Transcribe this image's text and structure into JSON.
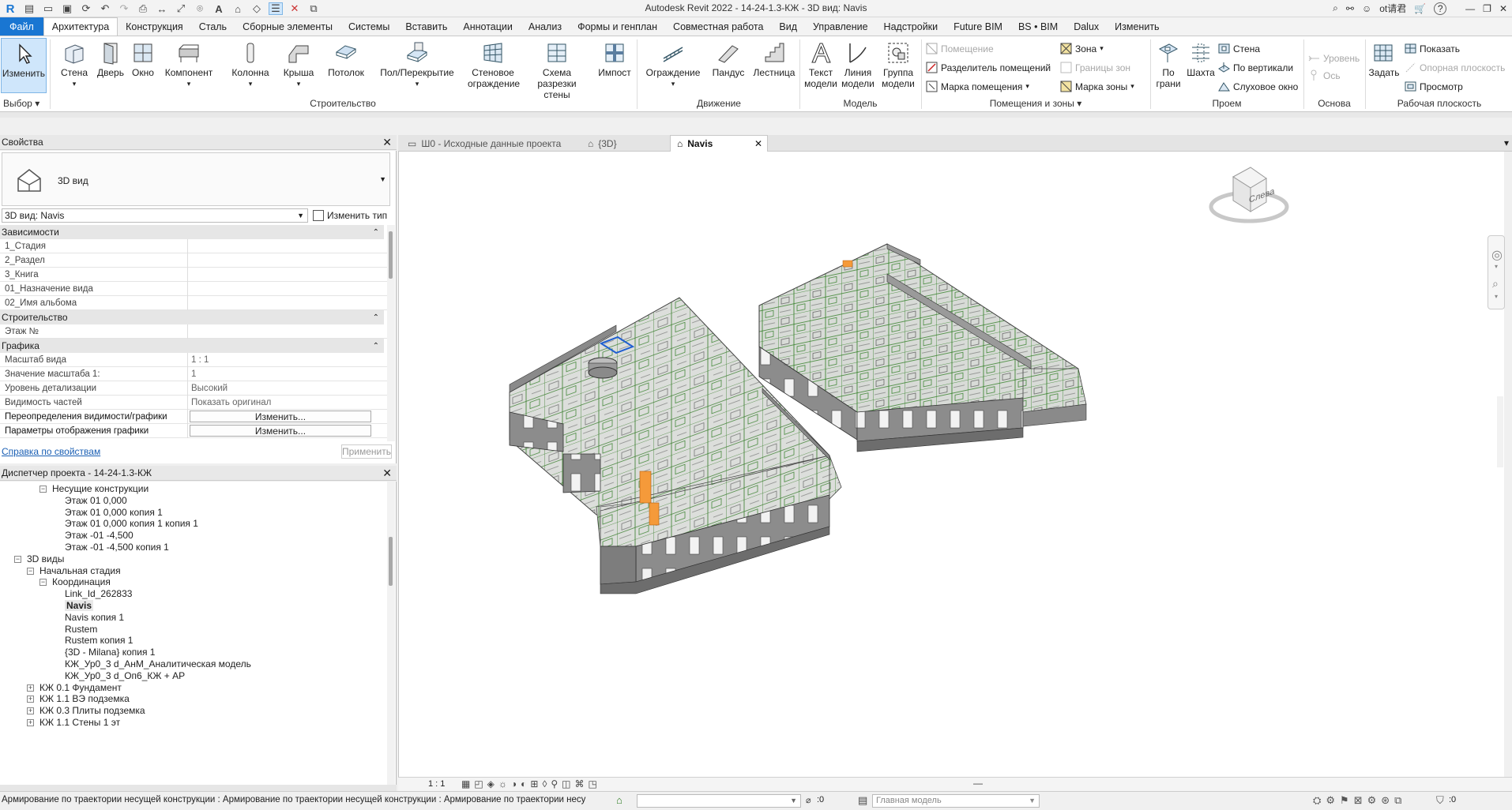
{
  "app": {
    "title": "Autodesk Revit 2022 - 14-24-1.3-КЖ - 3D вид: Navis",
    "right": {
      "user": "ot请君",
      "help": "?"
    }
  },
  "menu": {
    "tabs": [
      "Файл",
      "Архитектура",
      "Конструкция",
      "Сталь",
      "Сборные элементы",
      "Системы",
      "Вставить",
      "Аннотации",
      "Анализ",
      "Формы и генплан",
      "Совместная работа",
      "Вид",
      "Управление",
      "Надстройки",
      "Future BIM",
      "BS • BIM",
      "Dalux",
      "Изменить"
    ],
    "active": "Архитектура"
  },
  "ribbon": {
    "select": {
      "modify": "Изменить",
      "group": "Выбор"
    },
    "build": {
      "wall": "Стена",
      "door": "Дверь",
      "window": "Окно",
      "component": "Компонент",
      "column": "Колонна",
      "roof": "Крыша",
      "ceiling": "Потолок",
      "floor": "Пол/Перекрытие",
      "curtain_wall": "Стеновое ограждение",
      "curtain_grid": "Схема разрезки стены",
      "mullion": "Импост",
      "group": "Строительство"
    },
    "circulation": {
      "railing": "Ограждение",
      "ramp": "Пандус",
      "stair": "Лестница",
      "group": "Движение"
    },
    "model": {
      "text": "Текст модели",
      "line": "Линия модели",
      "group_btn": "Группа модели",
      "group": "Модель"
    },
    "rooms": {
      "room": "Помещение",
      "separator": "Разделитель помещений",
      "tag": "Марка помещения",
      "area": "Зона",
      "area_boundary": "Границы зон",
      "area_tag": "Марка зоны",
      "group": "Помещения и зоны"
    },
    "opening": {
      "by_face": "По грани",
      "shaft": "Шахта",
      "wall": "Стена",
      "vertical": "По вертикали",
      "dormer": "Слуховое окно",
      "group": "Проем"
    },
    "datum": {
      "level": "Уровень",
      "grid": "Ось",
      "group": "Основа"
    },
    "workplane": {
      "set": "Задать",
      "show": "Показать",
      "ref_plane": "Опорная плоскость",
      "viewer": "Просмотр",
      "group": "Рабочая плоскость"
    }
  },
  "properties": {
    "title": "Свойства",
    "type_name": "3D вид",
    "selector": "3D вид: Navis",
    "edit_type": "Изменить тип",
    "sections": [
      {
        "name": "Зависимости",
        "rows": [
          {
            "k": "1_Стадия",
            "v": ""
          },
          {
            "k": "2_Раздел",
            "v": ""
          },
          {
            "k": "3_Книга",
            "v": ""
          },
          {
            "k": "01_Назначение вида",
            "v": ""
          },
          {
            "k": "02_Имя альбома",
            "v": ""
          }
        ]
      },
      {
        "name": "Строительство",
        "rows": [
          {
            "k": "Этаж №",
            "v": ""
          }
        ]
      },
      {
        "name": "Графика",
        "rows": [
          {
            "k": "Масштаб вида",
            "v": "1 : 1"
          },
          {
            "k": "Значение масштаба    1:",
            "v": "1"
          },
          {
            "k": "Уровень детализации",
            "v": "Высокий"
          },
          {
            "k": "Видимость частей",
            "v": "Показать оригинал"
          }
        ]
      }
    ],
    "vg_overrides": "Переопределения видимости/графики",
    "display_options": "Параметры отображения графики",
    "edit_btn": "Изменить...",
    "help_link": "Справка по свойствам",
    "apply": "Применить"
  },
  "browser": {
    "title": "Диспетчер проекта - 14-24-1.3-КЖ",
    "items": [
      {
        "label": "Несущие конструкции",
        "indent": 4,
        "toggle": "−"
      },
      {
        "label": "Этаж 01 0,000",
        "indent": 5,
        "toggle": ""
      },
      {
        "label": "Этаж 01 0,000 копия 1",
        "indent": 5,
        "toggle": ""
      },
      {
        "label": "Этаж 01 0,000 копия 1 копия 1",
        "indent": 5,
        "toggle": ""
      },
      {
        "label": "Этаж -01 -4,500",
        "indent": 5,
        "toggle": ""
      },
      {
        "label": "Этаж -01 -4,500 копия 1",
        "indent": 5,
        "toggle": ""
      },
      {
        "label": "3D виды",
        "indent": 2,
        "toggle": "−"
      },
      {
        "label": "Начальная стадия",
        "indent": 3,
        "toggle": "−"
      },
      {
        "label": "Координация",
        "indent": 4,
        "toggle": "−"
      },
      {
        "label": "Link_Id_262833",
        "indent": 5,
        "toggle": ""
      },
      {
        "label": "Navis",
        "indent": 5,
        "toggle": "",
        "bold": true
      },
      {
        "label": "Navis копия 1",
        "indent": 5,
        "toggle": ""
      },
      {
        "label": "Rustem",
        "indent": 5,
        "toggle": ""
      },
      {
        "label": "Rustem копия 1",
        "indent": 5,
        "toggle": ""
      },
      {
        "label": "{3D - Milana} копия 1",
        "indent": 5,
        "toggle": ""
      },
      {
        "label": "КЖ_Ур0_3 d_АнМ_Аналитическая модель",
        "indent": 5,
        "toggle": ""
      },
      {
        "label": "КЖ_Ур0_3 d_Оп6_КЖ + АР",
        "indent": 5,
        "toggle": ""
      },
      {
        "label": "КЖ 0.1 Фундамент",
        "indent": 3,
        "toggle": "+"
      },
      {
        "label": "КЖ 1.1 ВЭ подземка",
        "indent": 3,
        "toggle": "+"
      },
      {
        "label": "КЖ 0.3 Плиты подземка",
        "indent": 3,
        "toggle": "+"
      },
      {
        "label": "КЖ 1.1 Стены 1 эт",
        "indent": 3,
        "toggle": "+"
      }
    ]
  },
  "view_tabs": [
    {
      "label": "Ш0 - Исходные данные проекта",
      "active": false
    },
    {
      "label": "{3D}",
      "active": false
    },
    {
      "label": "Navis",
      "active": true
    }
  ],
  "viewcube": {
    "face": "Слева"
  },
  "view_control": {
    "scale": "1 : 1"
  },
  "status": {
    "message": "Армирование по траектории несущей конструкции : Армирование по траектории несущей конструкции : Армирование по траектории несу",
    "count": ":0",
    "model": "Главная модель",
    "filter_count": ":0"
  },
  "colors": {
    "accent": "#1976d2",
    "rebar": "#2f7d24",
    "slab": "#d9dcd9",
    "wall": "#8a8a8a"
  }
}
